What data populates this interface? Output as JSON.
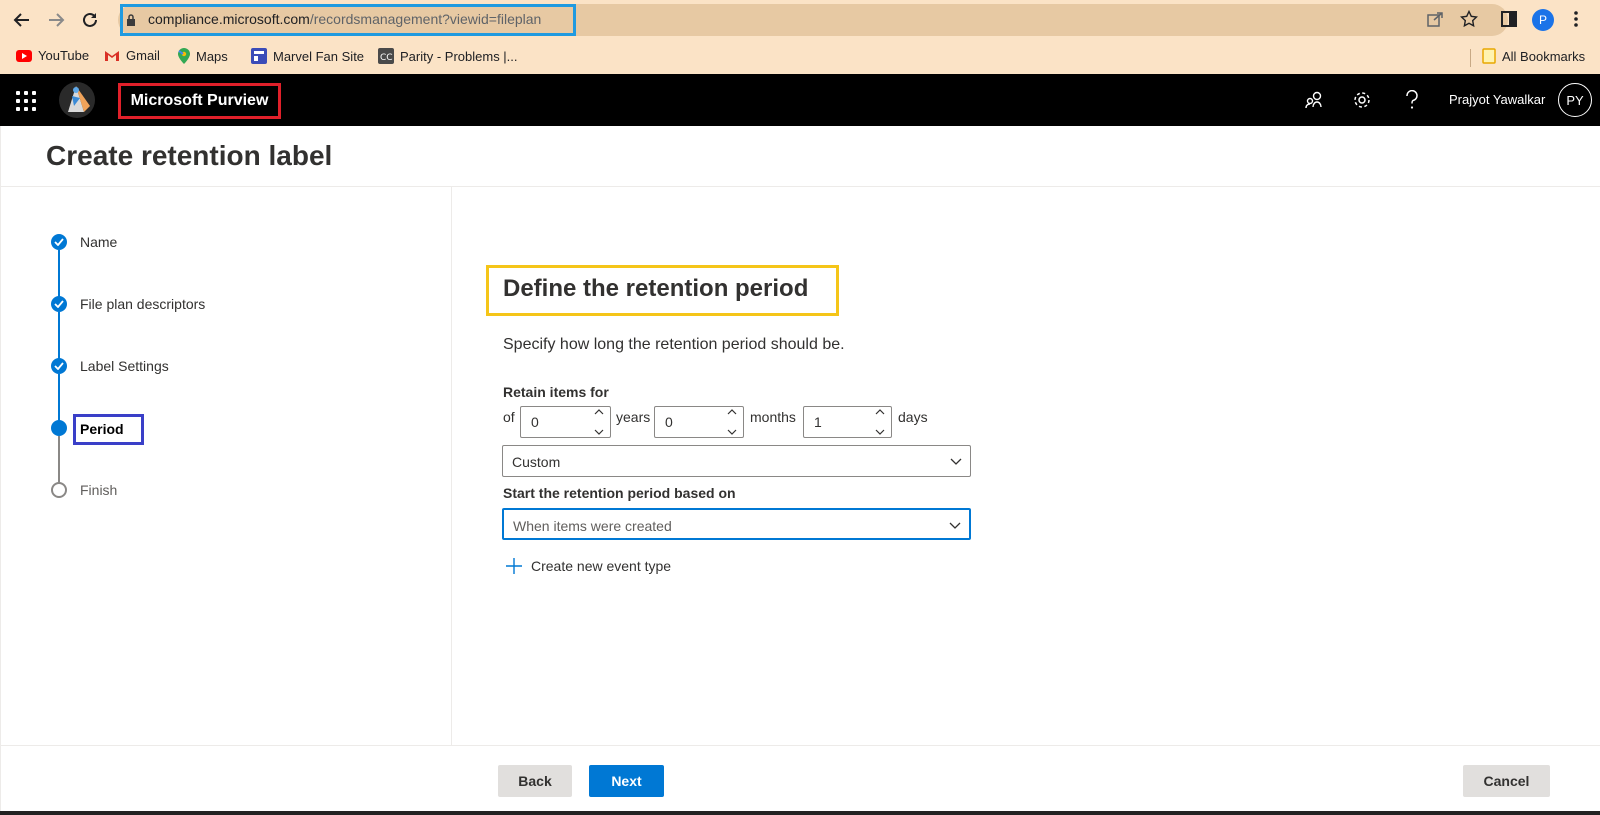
{
  "browser": {
    "url_host": "compliance.microsoft.com",
    "url_path": "/recordsmanagement?viewid=fileplan",
    "profile_initial": "P",
    "bookmarks": [
      {
        "label": "YouTube",
        "icon": "youtube-icon"
      },
      {
        "label": "Gmail",
        "icon": "gmail-icon"
      },
      {
        "label": "Maps",
        "icon": "maps-icon"
      },
      {
        "label": "Marvel Fan Site",
        "icon": "site-icon"
      },
      {
        "label": "Parity - Problems |...",
        "icon": "cc-icon"
      }
    ],
    "all_bookmarks": "All Bookmarks"
  },
  "appbar": {
    "brand": "Microsoft Purview",
    "user_name": "Prajyot Yawalkar",
    "avatar_initials": "PY"
  },
  "page": {
    "title": "Create retention label"
  },
  "steps": [
    {
      "label": "Name",
      "state": "done"
    },
    {
      "label": "File plan descriptors",
      "state": "done"
    },
    {
      "label": "Label Settings",
      "state": "done"
    },
    {
      "label": "Period",
      "state": "current"
    },
    {
      "label": "Finish",
      "state": "todo"
    }
  ],
  "content": {
    "heading": "Define the retention period",
    "description": "Specify how long the retention period should be.",
    "retain_label": "Retain items for",
    "of_text": "of",
    "years_value": "0",
    "years_text": "years",
    "months_value": "0",
    "months_text": "months",
    "days_value": "1",
    "days_text": "days",
    "period_dropdown": "Custom",
    "start_label": "Start the retention period based on",
    "start_dropdown": "When items were created",
    "create_event": "Create new event type"
  },
  "footer": {
    "back": "Back",
    "next": "Next",
    "cancel": "Cancel"
  },
  "colors": {
    "accent": "#0078d4",
    "url_highlight": "#1f9ae0",
    "brand_highlight": "#e0202a",
    "heading_highlight": "#f5c518",
    "period_highlight": "#3a3fc8"
  }
}
